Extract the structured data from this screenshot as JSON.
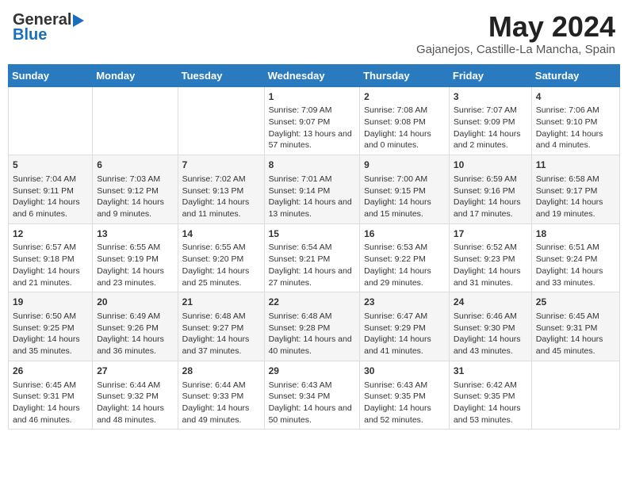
{
  "header": {
    "logo_general": "General",
    "logo_blue": "Blue",
    "month_title": "May 2024",
    "location": "Gajanejos, Castille-La Mancha, Spain"
  },
  "days_of_week": [
    "Sunday",
    "Monday",
    "Tuesday",
    "Wednesday",
    "Thursday",
    "Friday",
    "Saturday"
  ],
  "weeks": [
    [
      {
        "day": "",
        "info": ""
      },
      {
        "day": "",
        "info": ""
      },
      {
        "day": "",
        "info": ""
      },
      {
        "day": "1",
        "info": "Sunrise: 7:09 AM\nSunset: 9:07 PM\nDaylight: 13 hours and 57 minutes."
      },
      {
        "day": "2",
        "info": "Sunrise: 7:08 AM\nSunset: 9:08 PM\nDaylight: 14 hours and 0 minutes."
      },
      {
        "day": "3",
        "info": "Sunrise: 7:07 AM\nSunset: 9:09 PM\nDaylight: 14 hours and 2 minutes."
      },
      {
        "day": "4",
        "info": "Sunrise: 7:06 AM\nSunset: 9:10 PM\nDaylight: 14 hours and 4 minutes."
      }
    ],
    [
      {
        "day": "5",
        "info": "Sunrise: 7:04 AM\nSunset: 9:11 PM\nDaylight: 14 hours and 6 minutes."
      },
      {
        "day": "6",
        "info": "Sunrise: 7:03 AM\nSunset: 9:12 PM\nDaylight: 14 hours and 9 minutes."
      },
      {
        "day": "7",
        "info": "Sunrise: 7:02 AM\nSunset: 9:13 PM\nDaylight: 14 hours and 11 minutes."
      },
      {
        "day": "8",
        "info": "Sunrise: 7:01 AM\nSunset: 9:14 PM\nDaylight: 14 hours and 13 minutes."
      },
      {
        "day": "9",
        "info": "Sunrise: 7:00 AM\nSunset: 9:15 PM\nDaylight: 14 hours and 15 minutes."
      },
      {
        "day": "10",
        "info": "Sunrise: 6:59 AM\nSunset: 9:16 PM\nDaylight: 14 hours and 17 minutes."
      },
      {
        "day": "11",
        "info": "Sunrise: 6:58 AM\nSunset: 9:17 PM\nDaylight: 14 hours and 19 minutes."
      }
    ],
    [
      {
        "day": "12",
        "info": "Sunrise: 6:57 AM\nSunset: 9:18 PM\nDaylight: 14 hours and 21 minutes."
      },
      {
        "day": "13",
        "info": "Sunrise: 6:55 AM\nSunset: 9:19 PM\nDaylight: 14 hours and 23 minutes."
      },
      {
        "day": "14",
        "info": "Sunrise: 6:55 AM\nSunset: 9:20 PM\nDaylight: 14 hours and 25 minutes."
      },
      {
        "day": "15",
        "info": "Sunrise: 6:54 AM\nSunset: 9:21 PM\nDaylight: 14 hours and 27 minutes."
      },
      {
        "day": "16",
        "info": "Sunrise: 6:53 AM\nSunset: 9:22 PM\nDaylight: 14 hours and 29 minutes."
      },
      {
        "day": "17",
        "info": "Sunrise: 6:52 AM\nSunset: 9:23 PM\nDaylight: 14 hours and 31 minutes."
      },
      {
        "day": "18",
        "info": "Sunrise: 6:51 AM\nSunset: 9:24 PM\nDaylight: 14 hours and 33 minutes."
      }
    ],
    [
      {
        "day": "19",
        "info": "Sunrise: 6:50 AM\nSunset: 9:25 PM\nDaylight: 14 hours and 35 minutes."
      },
      {
        "day": "20",
        "info": "Sunrise: 6:49 AM\nSunset: 9:26 PM\nDaylight: 14 hours and 36 minutes."
      },
      {
        "day": "21",
        "info": "Sunrise: 6:48 AM\nSunset: 9:27 PM\nDaylight: 14 hours and 37 minutes."
      },
      {
        "day": "22",
        "info": "Sunrise: 6:48 AM\nSunset: 9:28 PM\nDaylight: 14 hours and 40 minutes."
      },
      {
        "day": "23",
        "info": "Sunrise: 6:47 AM\nSunset: 9:29 PM\nDaylight: 14 hours and 41 minutes."
      },
      {
        "day": "24",
        "info": "Sunrise: 6:46 AM\nSunset: 9:30 PM\nDaylight: 14 hours and 43 minutes."
      },
      {
        "day": "25",
        "info": "Sunrise: 6:45 AM\nSunset: 9:31 PM\nDaylight: 14 hours and 45 minutes."
      }
    ],
    [
      {
        "day": "26",
        "info": "Sunrise: 6:45 AM\nSunset: 9:31 PM\nDaylight: 14 hours and 46 minutes."
      },
      {
        "day": "27",
        "info": "Sunrise: 6:44 AM\nSunset: 9:32 PM\nDaylight: 14 hours and 48 minutes."
      },
      {
        "day": "28",
        "info": "Sunrise: 6:44 AM\nSunset: 9:33 PM\nDaylight: 14 hours and 49 minutes."
      },
      {
        "day": "29",
        "info": "Sunrise: 6:43 AM\nSunset: 9:34 PM\nDaylight: 14 hours and 50 minutes."
      },
      {
        "day": "30",
        "info": "Sunrise: 6:43 AM\nSunset: 9:35 PM\nDaylight: 14 hours and 52 minutes."
      },
      {
        "day": "31",
        "info": "Sunrise: 6:42 AM\nSunset: 9:35 PM\nDaylight: 14 hours and 53 minutes."
      },
      {
        "day": "",
        "info": ""
      }
    ]
  ]
}
